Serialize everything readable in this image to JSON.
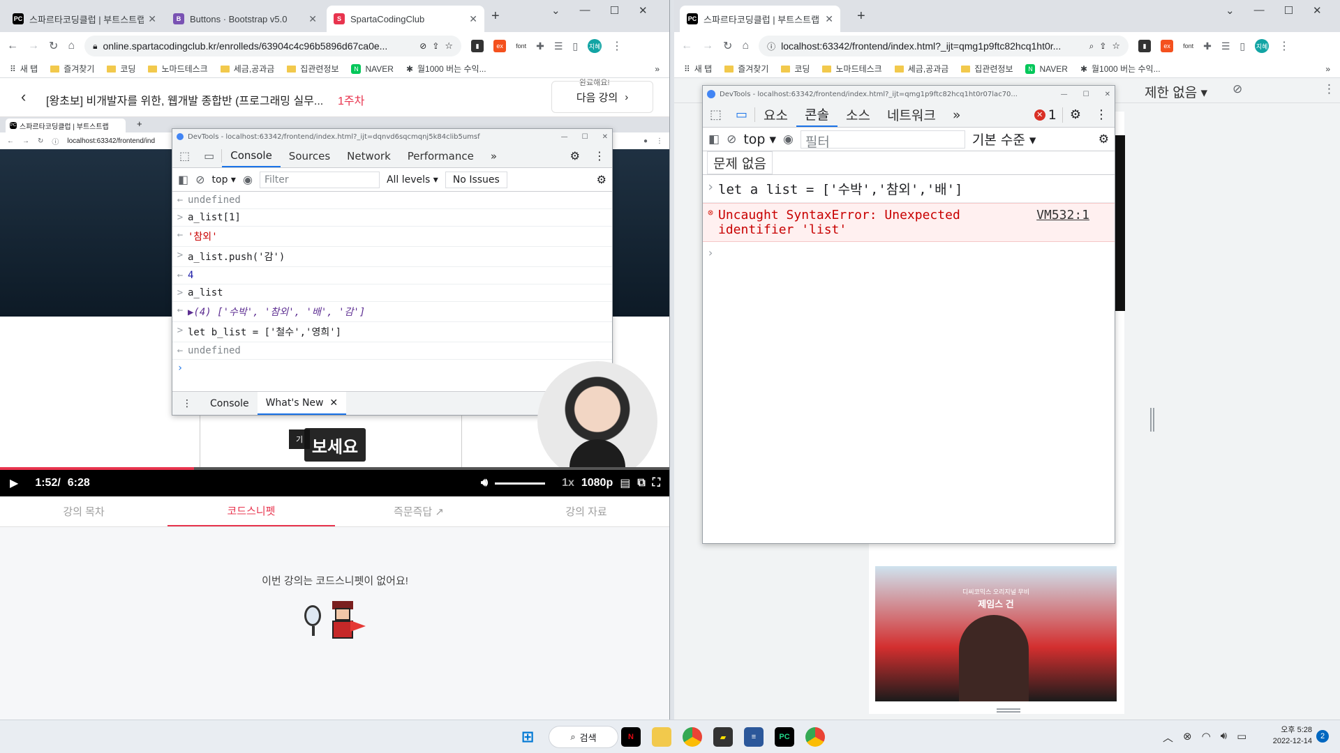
{
  "left_window": {
    "tabs": [
      {
        "title": "스파르타코딩클럽 | 부트스트랩",
        "favicon": "PC"
      },
      {
        "title": "Buttons · Bootstrap v5.0",
        "favicon": "B"
      },
      {
        "title": "SpartaCodingClub",
        "favicon": "S"
      }
    ],
    "url": "online.spartacodingclub.kr/enrolleds/63904c4c96b5896d67ca0e...",
    "bookmarks": [
      "새 탭",
      "즐겨찾기",
      "코딩",
      "노마드테스크",
      "세금,공과금",
      "집관련정보",
      "NAVER",
      "월1000 버는 수익..."
    ],
    "course_title": "[왕초보] 비개발자를 위한, 웹개발 종합반 (프로그래밍 실무...",
    "week_label": "1주차",
    "next_lecture": "다음 강의",
    "next_hint": "완료해요!",
    "video": {
      "inner_tab_title": "스파르타코딩클럽 | 부트스트랩",
      "inner_url": "localhost:63342/frontend/ind",
      "devtools_title": "DevTools - localhost:63342/frontend/index.html?_ijt=dqnvd6sqcmqnj5k84clib5umsf",
      "devtools_tabs": [
        "Console",
        "Sources",
        "Network",
        "Performance"
      ],
      "more_tabs": "»",
      "context": "top",
      "filter_placeholder": "Filter",
      "levels": "All levels",
      "issues": "No Issues",
      "console_lines": [
        {
          "prefix": "←",
          "text": "undefined",
          "kind": "result"
        },
        {
          "prefix": ">",
          "text": "a_list[1]",
          "kind": "input"
        },
        {
          "prefix": "←",
          "text": "'참외'",
          "kind": "string"
        },
        {
          "prefix": ">",
          "text": "a_list.push('감')",
          "kind": "input"
        },
        {
          "prefix": "←",
          "text": "4",
          "kind": "number"
        },
        {
          "prefix": ">",
          "text": "a_list",
          "kind": "input"
        },
        {
          "prefix": "←",
          "text": "▶(4) ['수박', '참외', '배', '감']",
          "kind": "array"
        },
        {
          "prefix": ">",
          "text": "let b_list = ['철수','영희']",
          "kind": "input"
        },
        {
          "prefix": "←",
          "text": "undefined",
          "kind": "result"
        }
      ],
      "drawer_tabs": [
        "Console",
        "What's New"
      ],
      "subtitle": "보세요",
      "subtitle_small": "기",
      "current_time": "1:52/",
      "duration": "6:28",
      "speed": "1x",
      "quality": "1080p",
      "progress_percent": 29
    },
    "lecture_tabs": [
      "강의 목차",
      "코드스니펫",
      "즉문즉답",
      "강의 자료"
    ],
    "active_lecture_tab": 1,
    "empty_message": "이번 강의는 코드스니펫이 없어요!"
  },
  "right_window": {
    "tab_title": "스파르타코딩클럽 | 부트스트랩",
    "url": "localhost:63342/frontend/index.html?_ijt=qmg1p9ftc82hcq1ht0r...",
    "bookmarks": [
      "새 탭",
      "즐겨찾기",
      "코딩",
      "노마드테스크",
      "세금,공과금",
      "집관련정보",
      "NAVER",
      "월1000 버는 수익..."
    ],
    "throttle": "제한 없음",
    "devtools": {
      "title": "DevTools - localhost:63342/frontend/index.html?_ijt=qmg1p9ftc82hcq1ht0r07lac70...",
      "tabs": [
        "요소",
        "콘솔",
        "소스",
        "네트워크"
      ],
      "more_tabs": "»",
      "error_count": "1",
      "context": "top",
      "filter_placeholder": "필터",
      "levels": "기본 수준",
      "issues": "문제 없음",
      "input_line": "let a list = ['수박','참외','배']",
      "error_line1": "Uncaught SyntaxError: Unexpected",
      "error_line2": "identifier 'list'",
      "error_source": "VM532:1"
    },
    "poster_lines": [
      "디씨코믹스 오리지널 무비",
      "제임스 건"
    ]
  },
  "taskbar": {
    "search": "검색",
    "time": "오후 5:28",
    "date": "2022-12-14",
    "notifications": "2"
  },
  "colors": {
    "sparta_red": "#e8344e",
    "devtools_blue": "#1a73e8",
    "error_red": "#c80000",
    "error_bg": "#fff0f0"
  }
}
